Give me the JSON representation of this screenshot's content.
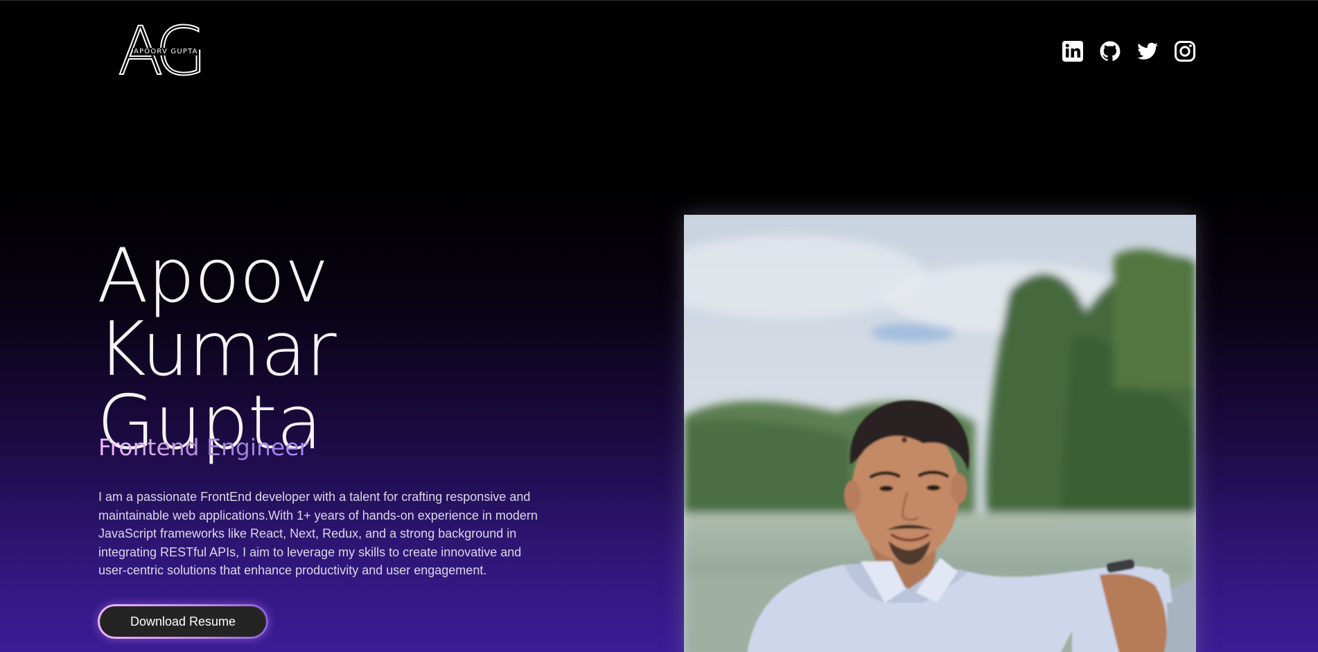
{
  "header": {
    "logo_monogram": "AG",
    "logo_name": "APOORV GUPTA",
    "socials": [
      {
        "icon": "linkedin-icon"
      },
      {
        "icon": "github-icon"
      },
      {
        "icon": "twitter-icon"
      },
      {
        "icon": "instagram-icon"
      }
    ]
  },
  "hero": {
    "name_line1": "Apoov Kumar",
    "name_line2": "Gupta",
    "role": "Frontend Engineer",
    "bio": "I am a passionate FrontEnd developer with a talent for crafting responsive and maintainable web applications.With 1+ years of hands-on experience in modern JavaScript frameworks like React, Next, Redux, and a strong background in integrating RESTful APIs, I aim to leverage my skills to create innovative and user-centric solutions that enhance productivity and user engagement.",
    "button_label": "Download Resume"
  },
  "colors": {
    "background_top": "#000000",
    "background_bottom": "#3b1c96",
    "role_gradient_start": "#f4b7ff",
    "role_gradient_end": "#a78bfa",
    "button_bg": "#242424"
  }
}
